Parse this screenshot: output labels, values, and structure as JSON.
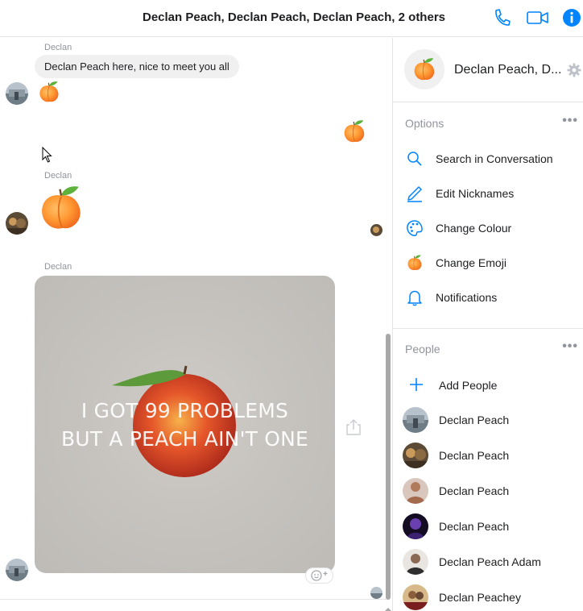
{
  "header": {
    "title": "Declan Peach, Declan Peach, Declan Peach, 2 others",
    "icons": [
      "phone-icon",
      "video-camera-icon",
      "info-icon"
    ],
    "accent": "#0084ff"
  },
  "messages": {
    "sender_1": "Declan",
    "text_1": "Declan Peach here, nice to meet you all",
    "sender_2": "Declan",
    "sender_3": "Declan",
    "image_caption_line1": "I GOT 99 PROBLEMS",
    "image_caption_line2": "BUT A PEACH AIN'T ONE"
  },
  "sidebar": {
    "conversation_name": "Declan Peach, D...",
    "options_title": "Options",
    "options": [
      {
        "label": "Search in Conversation",
        "icon": "search-icon"
      },
      {
        "label": "Edit Nicknames",
        "icon": "pencil-icon"
      },
      {
        "label": "Change Colour",
        "icon": "palette-icon"
      },
      {
        "label": "Change Emoji",
        "icon": "peach-emoji-icon"
      },
      {
        "label": "Notifications",
        "icon": "bell-icon"
      }
    ],
    "people_title": "People",
    "add_people": "Add People",
    "people": [
      {
        "name": "Declan Peach"
      },
      {
        "name": "Declan Peach"
      },
      {
        "name": "Declan Peach"
      },
      {
        "name": "Declan Peach"
      },
      {
        "name": "Declan Peach Adam"
      },
      {
        "name": "Declan Peachey"
      }
    ]
  }
}
